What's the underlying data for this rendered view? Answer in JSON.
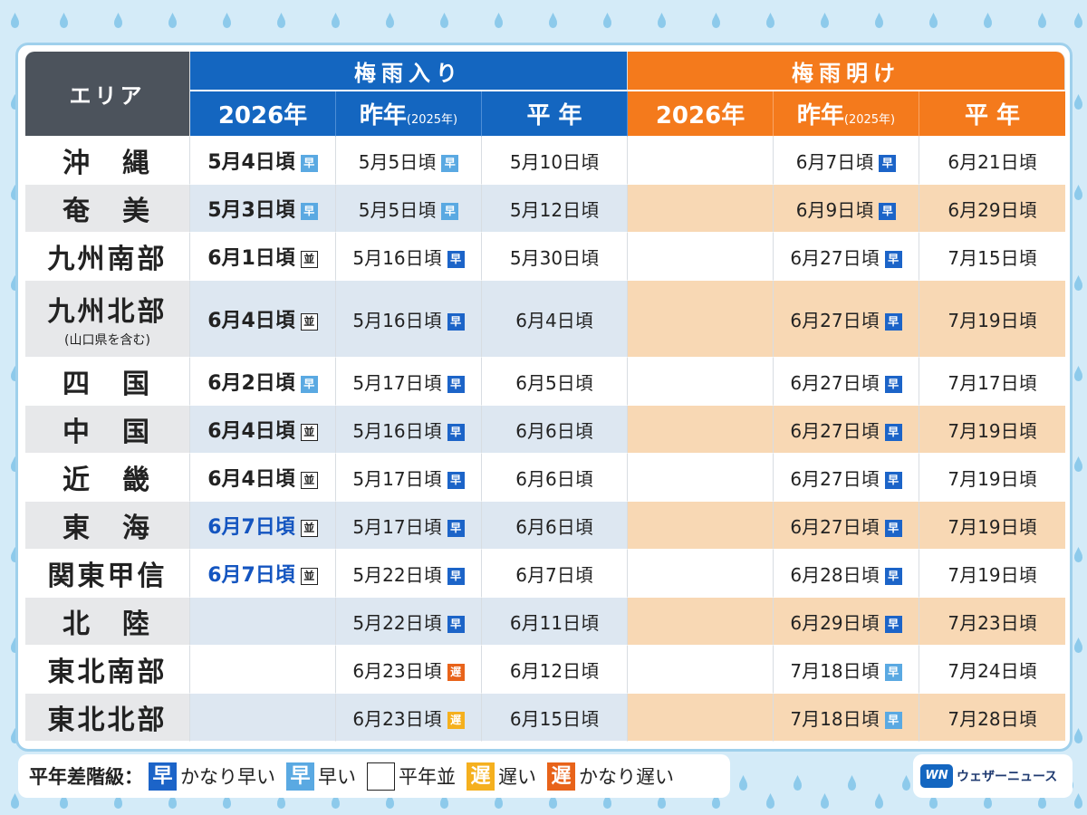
{
  "headers": {
    "area": "エリア",
    "tsuyu_iri": "梅雨入り",
    "tsuyu_ake": "梅雨明け",
    "y2026": "2026年",
    "last_year": "昨年",
    "last_year_sub": "(2025年)",
    "normal": "平 年"
  },
  "badge_labels": {
    "vearly": "早",
    "early": "早",
    "normal": "並",
    "late": "遅",
    "vlate": "遅"
  },
  "rows": [
    {
      "name": "沖　縄",
      "name_sub": "",
      "iri_2026": "5月4日頃",
      "iri_2026_badge": "early",
      "iri_2026_blue": false,
      "iri_ly": "5月5日頃",
      "iri_ly_badge": "early",
      "iri_nm": "5月10日頃",
      "ake_2026": "",
      "ake_ly": "6月7日頃",
      "ake_ly_badge": "vearly",
      "ake_nm": "6月21日頃"
    },
    {
      "name": "奄　美",
      "name_sub": "",
      "iri_2026": "5月3日頃",
      "iri_2026_badge": "early",
      "iri_2026_blue": false,
      "iri_ly": "5月5日頃",
      "iri_ly_badge": "early",
      "iri_nm": "5月12日頃",
      "ake_2026": "",
      "ake_ly": "6月9日頃",
      "ake_ly_badge": "vearly",
      "ake_nm": "6月29日頃"
    },
    {
      "name": "九州南部",
      "name_sub": "",
      "iri_2026": "6月1日頃",
      "iri_2026_badge": "normal",
      "iri_2026_blue": false,
      "iri_ly": "5月16日頃",
      "iri_ly_badge": "vearly",
      "iri_nm": "5月30日頃",
      "ake_2026": "",
      "ake_ly": "6月27日頃",
      "ake_ly_badge": "vearly",
      "ake_nm": "7月15日頃"
    },
    {
      "name": "九州北部",
      "name_sub": "(山口県を含む)",
      "iri_2026": "6月4日頃",
      "iri_2026_badge": "normal",
      "iri_2026_blue": false,
      "iri_ly": "5月16日頃",
      "iri_ly_badge": "vearly",
      "iri_nm": "6月4日頃",
      "ake_2026": "",
      "ake_ly": "6月27日頃",
      "ake_ly_badge": "vearly",
      "ake_nm": "7月19日頃"
    },
    {
      "name": "四　国",
      "name_sub": "",
      "iri_2026": "6月2日頃",
      "iri_2026_badge": "early",
      "iri_2026_blue": false,
      "iri_ly": "5月17日頃",
      "iri_ly_badge": "vearly",
      "iri_nm": "6月5日頃",
      "ake_2026": "",
      "ake_ly": "6月27日頃",
      "ake_ly_badge": "vearly",
      "ake_nm": "7月17日頃"
    },
    {
      "name": "中　国",
      "name_sub": "",
      "iri_2026": "6月4日頃",
      "iri_2026_badge": "normal",
      "iri_2026_blue": false,
      "iri_ly": "5月16日頃",
      "iri_ly_badge": "vearly",
      "iri_nm": "6月6日頃",
      "ake_2026": "",
      "ake_ly": "6月27日頃",
      "ake_ly_badge": "vearly",
      "ake_nm": "7月19日頃"
    },
    {
      "name": "近　畿",
      "name_sub": "",
      "iri_2026": "6月4日頃",
      "iri_2026_badge": "normal",
      "iri_2026_blue": false,
      "iri_ly": "5月17日頃",
      "iri_ly_badge": "vearly",
      "iri_nm": "6月6日頃",
      "ake_2026": "",
      "ake_ly": "6月27日頃",
      "ake_ly_badge": "vearly",
      "ake_nm": "7月19日頃"
    },
    {
      "name": "東　海",
      "name_sub": "",
      "iri_2026": "6月7日頃",
      "iri_2026_badge": "normal",
      "iri_2026_blue": true,
      "iri_ly": "5月17日頃",
      "iri_ly_badge": "vearly",
      "iri_nm": "6月6日頃",
      "ake_2026": "",
      "ake_ly": "6月27日頃",
      "ake_ly_badge": "vearly",
      "ake_nm": "7月19日頃"
    },
    {
      "name": "関東甲信",
      "name_sub": "",
      "iri_2026": "6月7日頃",
      "iri_2026_badge": "normal",
      "iri_2026_blue": true,
      "iri_ly": "5月22日頃",
      "iri_ly_badge": "vearly",
      "iri_nm": "6月7日頃",
      "ake_2026": "",
      "ake_ly": "6月28日頃",
      "ake_ly_badge": "vearly",
      "ake_nm": "7月19日頃"
    },
    {
      "name": "北　陸",
      "name_sub": "",
      "iri_2026": "",
      "iri_2026_badge": "",
      "iri_2026_blue": false,
      "iri_ly": "5月22日頃",
      "iri_ly_badge": "vearly",
      "iri_nm": "6月11日頃",
      "ake_2026": "",
      "ake_ly": "6月29日頃",
      "ake_ly_badge": "vearly",
      "ake_nm": "7月23日頃"
    },
    {
      "name": "東北南部",
      "name_sub": "",
      "iri_2026": "",
      "iri_2026_badge": "",
      "iri_2026_blue": false,
      "iri_ly": "6月23日頃",
      "iri_ly_badge": "vlate",
      "iri_nm": "6月12日頃",
      "ake_2026": "",
      "ake_ly": "7月18日頃",
      "ake_ly_badge": "early",
      "ake_nm": "7月24日頃"
    },
    {
      "name": "東北北部",
      "name_sub": "",
      "iri_2026": "",
      "iri_2026_badge": "",
      "iri_2026_blue": false,
      "iri_ly": "6月23日頃",
      "iri_ly_badge": "late",
      "iri_nm": "6月15日頃",
      "ake_2026": "",
      "ake_ly": "7月18日頃",
      "ake_ly_badge": "early",
      "ake_nm": "7月28日頃"
    }
  ],
  "legend": {
    "title": "平年差階級：",
    "items": [
      {
        "badge": "vearly",
        "glyph": "早",
        "text": "かなり早い"
      },
      {
        "badge": "early",
        "glyph": "早",
        "text": "早い"
      },
      {
        "badge": "normal",
        "glyph": "並",
        "text": "平年並"
      },
      {
        "badge": "late",
        "glyph": "遅",
        "text": "遅い"
      },
      {
        "badge": "vlate",
        "glyph": "遅",
        "text": "かなり遅い"
      }
    ]
  },
  "brand": {
    "logo": "WN",
    "name": "ウェザーニュース"
  },
  "colors": {
    "tsuyu_iri": "#1466c0",
    "tsuyu_ake": "#f47a1c",
    "area_header": "#4c535c",
    "badge_vearly": "#1c64c8",
    "badge_early": "#5aa9e2",
    "badge_late": "#f5b01e",
    "badge_vlate": "#e8631a"
  }
}
